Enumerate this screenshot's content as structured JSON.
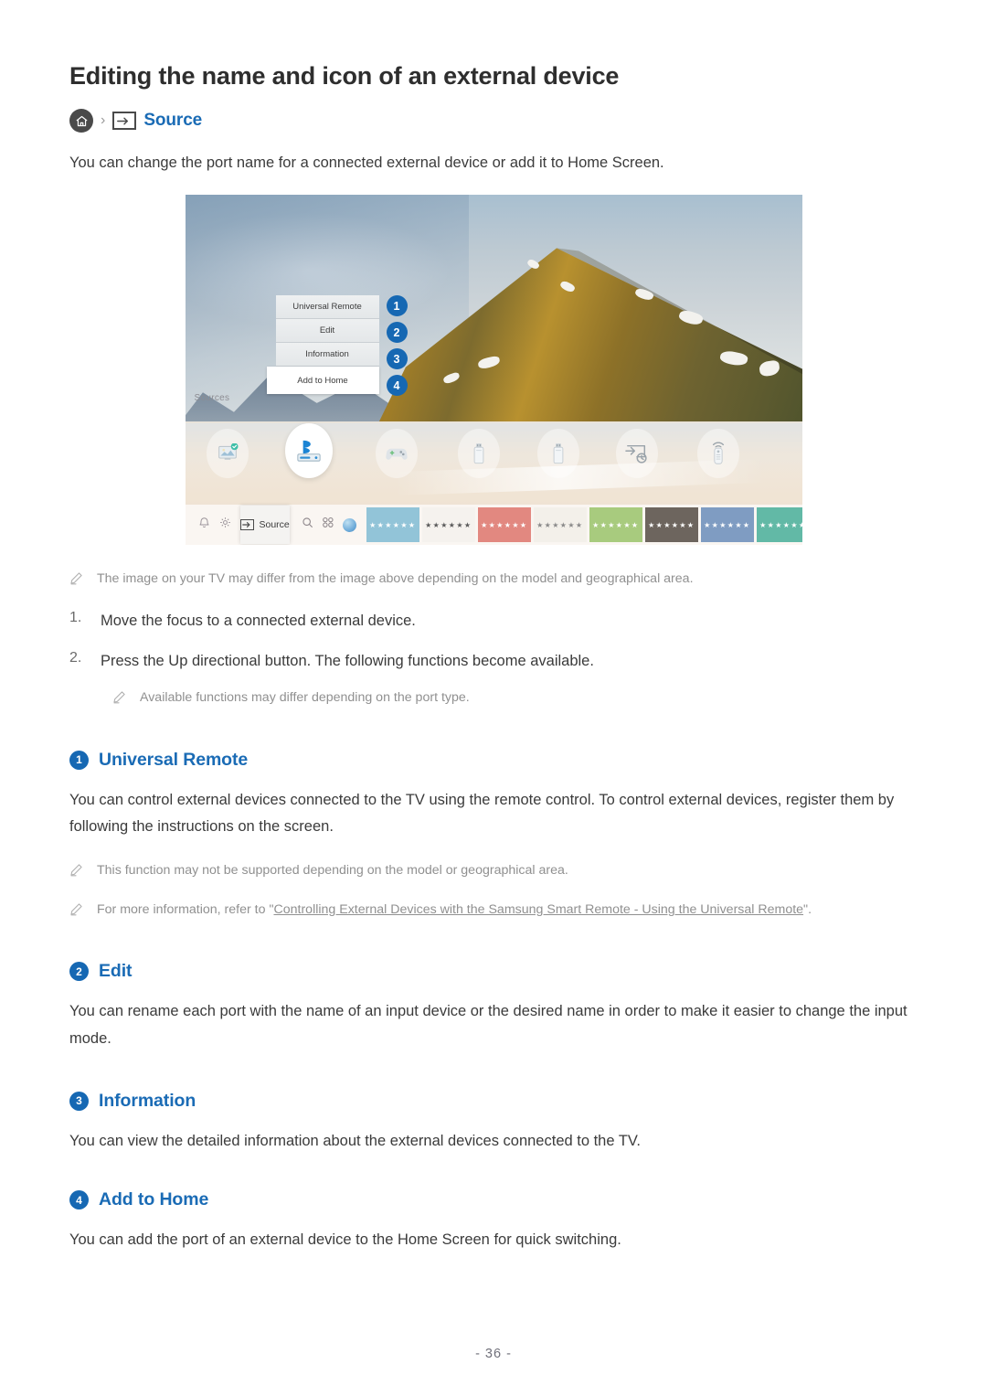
{
  "page": {
    "title": "Editing the name and icon of an external device",
    "intro": "You can change the port name for a connected external device or add it to Home Screen.",
    "footer": "- 36 -",
    "accent_color": "#1a6bb5",
    "badge_color": "#1668b3",
    "note_color": "#909090"
  },
  "breadcrumb": {
    "home_icon": "home-icon",
    "separator": "›",
    "source_icon": "source-input-icon",
    "label": "Source"
  },
  "tv_figure": {
    "sources_label": "Sources",
    "menu": [
      {
        "label": "Universal Remote",
        "badge": "1"
      },
      {
        "label": "Edit",
        "badge": "2"
      },
      {
        "label": "Information",
        "badge": "3"
      },
      {
        "label": "Add to Home",
        "badge": "4"
      }
    ],
    "devices": [
      {
        "name": "tv-monitor-icon",
        "state": "connected"
      },
      {
        "name": "bluray-player-icon",
        "state": "focused"
      },
      {
        "name": "game-controller-icon",
        "state": "dim"
      },
      {
        "name": "usb-drive-icon",
        "state": "dim"
      },
      {
        "name": "usb-drive-icon-2",
        "state": "dim"
      },
      {
        "name": "screen-mirroring-icon",
        "state": "dim"
      },
      {
        "name": "remote-control-icon",
        "state": "dim"
      }
    ],
    "bottom_bar": {
      "notification_icon": "bell-icon",
      "settings_icon": "gear-icon",
      "source_button_label": "Source",
      "source_button_icon": "source-input-icon",
      "search_icon": "search-icon",
      "apps_icon": "apps-grid-icon",
      "orb_icon": "browser-orb-icon",
      "tile_label": "★★★★★★",
      "tile_colors": [
        "#92c4d8",
        "#f5f2ee",
        "#e28880",
        "#f3f0ea",
        "#a8cb7e",
        "#6d655e",
        "#7f9cc2",
        "#62b9a6"
      ],
      "tile_text_colors": [
        "#ffffff",
        "#5a5a5a",
        "#ffffff",
        "#8a8a8a",
        "#ffffff",
        "#ffffff",
        "#ffffff",
        "#ffffff"
      ]
    }
  },
  "notes": {
    "image_differ": "The image on your TV may differ from the image above depending on the model and geographical area.",
    "port_type": "Available functions may differ depending on the port type.",
    "not_supported": "This function may not be supported depending on the model or geographical area.",
    "more_info_prefix": "For more information, refer to \"",
    "more_info_link": "Controlling External Devices with the Samsung Smart Remote - Using the Universal Remote",
    "more_info_suffix": "\"."
  },
  "steps": [
    {
      "num": "1.",
      "text": "Move the focus to a connected external device."
    },
    {
      "num": "2.",
      "text": "Press the Up directional button. The following functions become available."
    }
  ],
  "sections": [
    {
      "badge": "1",
      "title": "Universal Remote",
      "body": "You can control external devices connected to the TV using the remote control. To control external devices, register them by following the instructions on the screen."
    },
    {
      "badge": "2",
      "title": "Edit",
      "body": "You can rename each port with the name of an input device or the desired name in order to make it easier to change the input mode."
    },
    {
      "badge": "3",
      "title": "Information",
      "body": "You can view the detailed information about the external devices connected to the TV."
    },
    {
      "badge": "4",
      "title": "Add to Home",
      "body": "You can add the port of an external device to the Home Screen for quick switching."
    }
  ]
}
